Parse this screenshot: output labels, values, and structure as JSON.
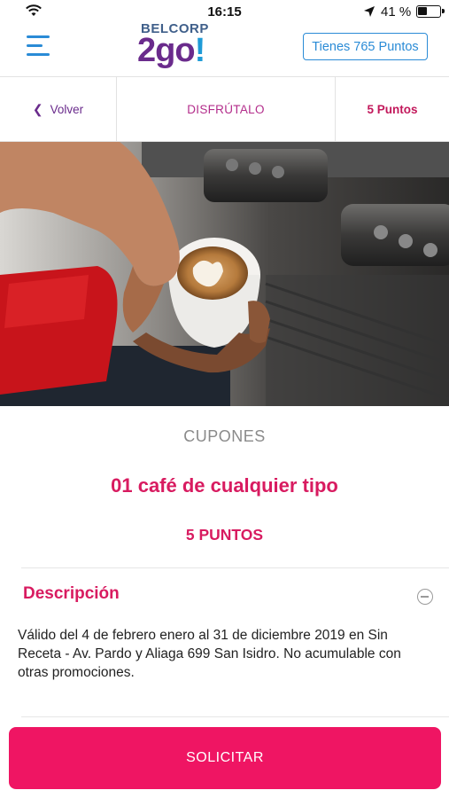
{
  "status_bar": {
    "time": "16:15",
    "battery_percent": "41 %",
    "icons": [
      "wifi-icon",
      "location-arrow-icon",
      "battery-icon"
    ]
  },
  "header": {
    "logo_top": "BELCORP",
    "logo_main": "2go",
    "logo_bang": "!",
    "points_button": "Tienes 765 Puntos",
    "menu_icon": "hamburger-menu-icon"
  },
  "tabbar": {
    "back_label": "Volver",
    "middle_label": "DISFRÚTALO",
    "points_label": "5 Puntos"
  },
  "content": {
    "kicker": "CUPONES",
    "title": "01 café de cualquier tipo",
    "points": "5 PUNTOS",
    "description_title": "Descripción",
    "description": "Válido del 4 de febrero enero al 31 de diciembre 2019 en Sin Receta - Av. Pardo y Aliaga 699 San Isidro. No acumulable con otras promociones."
  },
  "cta": {
    "label": "SOLICITAR"
  },
  "colors": {
    "accent_pink": "#d81b60",
    "button_pink": "#ef1563",
    "brand_blue": "#2a8bd6",
    "brand_purple": "#6a2b8c"
  }
}
